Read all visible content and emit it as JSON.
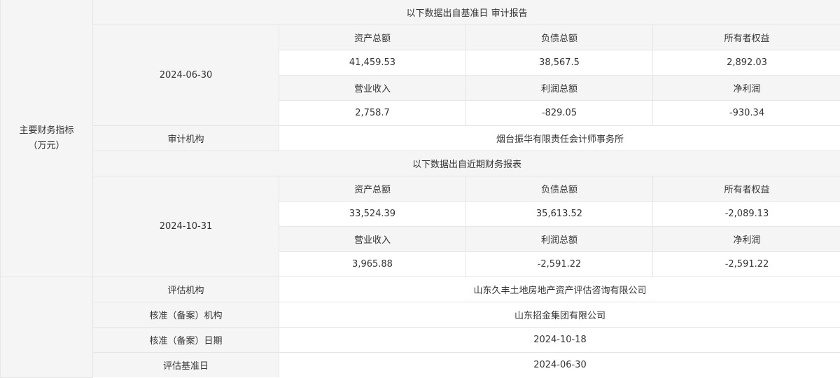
{
  "side_label": {
    "line1": "主要财务指标",
    "line2": "（万元）"
  },
  "audit_section": {
    "heading": "以下数据出自基准日 审计报告",
    "date": "2024-06-30",
    "headers_row1": [
      "资产总额",
      "负债总额",
      "所有者权益"
    ],
    "values_row1": [
      "41,459.53",
      "38,567.5",
      "2,892.03"
    ],
    "headers_row2": [
      "营业收入",
      "利润总额",
      "净利润"
    ],
    "values_row2": [
      "2,758.7",
      "-829.05",
      "-930.34"
    ],
    "auditor_label": "审计机构",
    "auditor_value": "烟台振华有限责任会计师事务所"
  },
  "recent_section": {
    "heading": "以下数据出自近期财务报表",
    "date": "2024-10-31",
    "headers_row1": [
      "资产总额",
      "负债总额",
      "所有者权益"
    ],
    "values_row1": [
      "33,524.39",
      "35,613.52",
      "-2,089.13"
    ],
    "headers_row2": [
      "营业收入",
      "利润总额",
      "净利润"
    ],
    "values_row2": [
      "3,965.88",
      "-2,591.22",
      "-2,591.22"
    ]
  },
  "evaluation": {
    "agency_label": "评估机构",
    "agency_value": "山东久丰土地房地产资产评估咨询有限公司",
    "approval_agency_label": "核准（备案）机构",
    "approval_agency_value": "山东招金集团有限公司",
    "approval_date_label": "核准（备案）日期",
    "approval_date_value": "2024-10-18",
    "base_date_label": "评估基准日",
    "base_date_value": "2024-06-30"
  }
}
